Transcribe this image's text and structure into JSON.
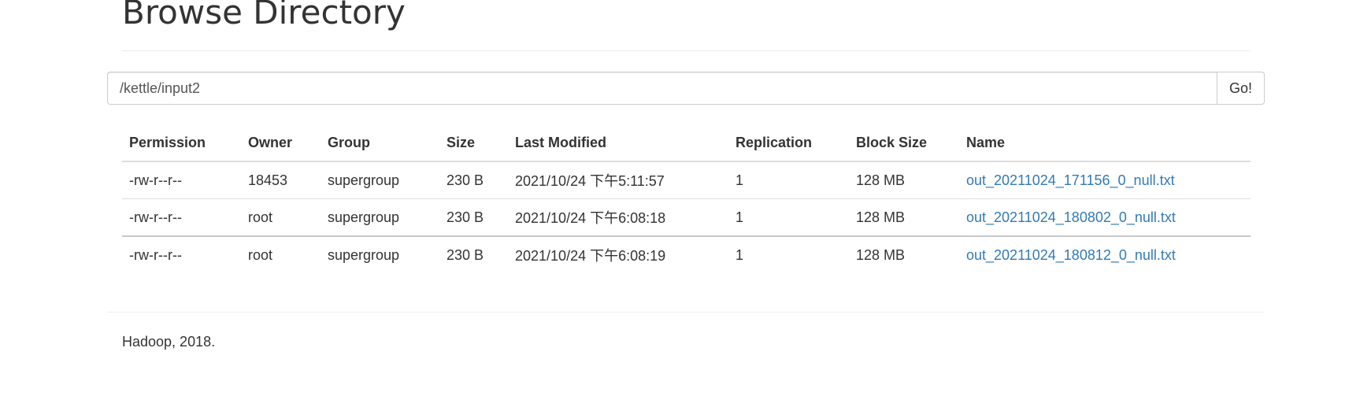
{
  "header": {
    "title": "Browse Directory"
  },
  "path_bar": {
    "value": "/kettle/input2",
    "go_label": "Go!"
  },
  "table": {
    "columns": [
      "Permission",
      "Owner",
      "Group",
      "Size",
      "Last Modified",
      "Replication",
      "Block Size",
      "Name"
    ],
    "rows": [
      [
        "-rw-r--r--",
        "18453",
        "supergroup",
        "230 B",
        "2021/10/24 下午5:11:57",
        "1",
        "128 MB",
        "out_20211024_171156_0_null.txt"
      ],
      [
        "-rw-r--r--",
        "root",
        "supergroup",
        "230 B",
        "2021/10/24 下午6:08:18",
        "1",
        "128 MB",
        "out_20211024_180802_0_null.txt"
      ],
      [
        "-rw-r--r--",
        "root",
        "supergroup",
        "230 B",
        "2021/10/24 下午6:08:19",
        "1",
        "128 MB",
        "out_20211024_180812_0_null.txt"
      ]
    ]
  },
  "footer": {
    "text": "Hadoop, 2018."
  },
  "colors": {
    "link": "#337ab7",
    "text": "#333333",
    "border": "#dddddd"
  }
}
